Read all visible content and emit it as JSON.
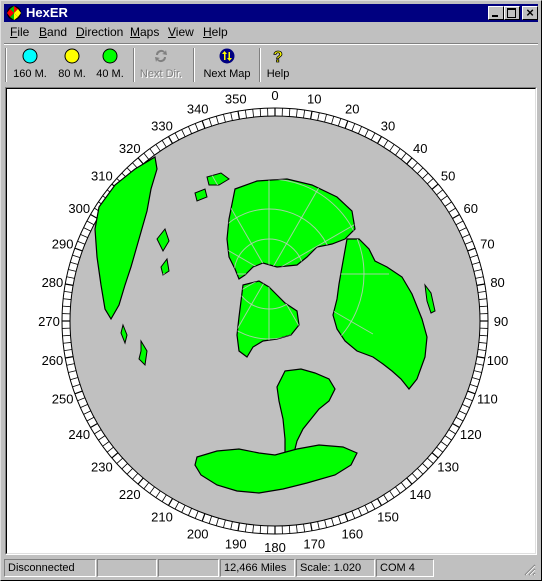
{
  "window": {
    "title": "HexER",
    "controls": {
      "minimize": "_",
      "maximize": "□",
      "close": "×"
    }
  },
  "menu": [
    {
      "label": "File",
      "accel": "F",
      "rest": "ile"
    },
    {
      "label": "Band",
      "accel": "B",
      "rest": "and"
    },
    {
      "label": "Direction",
      "accel": "D",
      "rest": "irection"
    },
    {
      "label": "Maps",
      "accel": "M",
      "rest": "aps"
    },
    {
      "label": "View",
      "accel": "V",
      "rest": "iew"
    },
    {
      "label": "Help",
      "accel": "H",
      "rest": "elp"
    }
  ],
  "toolbar": {
    "band_160": {
      "label": "160 M.",
      "icon": "circle-cyan",
      "color": "#00ffff"
    },
    "band_80": {
      "label": "80 M.",
      "icon": "circle-yellow",
      "color": "#ffff00"
    },
    "band_40": {
      "label": "40 M.",
      "icon": "circle-green",
      "color": "#00ff00"
    },
    "next_dir": {
      "label": "Next Dir.",
      "icon": "rotate-arrows",
      "enabled": false
    },
    "next_map": {
      "label": "Next Map",
      "icon": "swap-arrows-globe"
    },
    "help": {
      "label": "Help",
      "icon": "question-mark"
    }
  },
  "map": {
    "type": "azimuthal-equidistant",
    "bearing_labels": [
      "0",
      "10",
      "20",
      "30",
      "40",
      "50",
      "60",
      "70",
      "80",
      "90",
      "100",
      "110",
      "120",
      "130",
      "140",
      "150",
      "160",
      "170",
      "180",
      "190",
      "200",
      "210",
      "220",
      "230",
      "240",
      "250",
      "260",
      "270",
      "280",
      "290",
      "300",
      "310",
      "320",
      "330",
      "340",
      "350"
    ],
    "colors": {
      "land": "#00ff00",
      "ocean": "#c0c0c0",
      "grid": "#c8c8c8",
      "border": "#000000"
    }
  },
  "status": {
    "connection": "Disconnected",
    "panel2": "",
    "panel3": "",
    "distance": "12,466 Miles",
    "scale": "Scale: 1.020",
    "port": "COM 4"
  }
}
